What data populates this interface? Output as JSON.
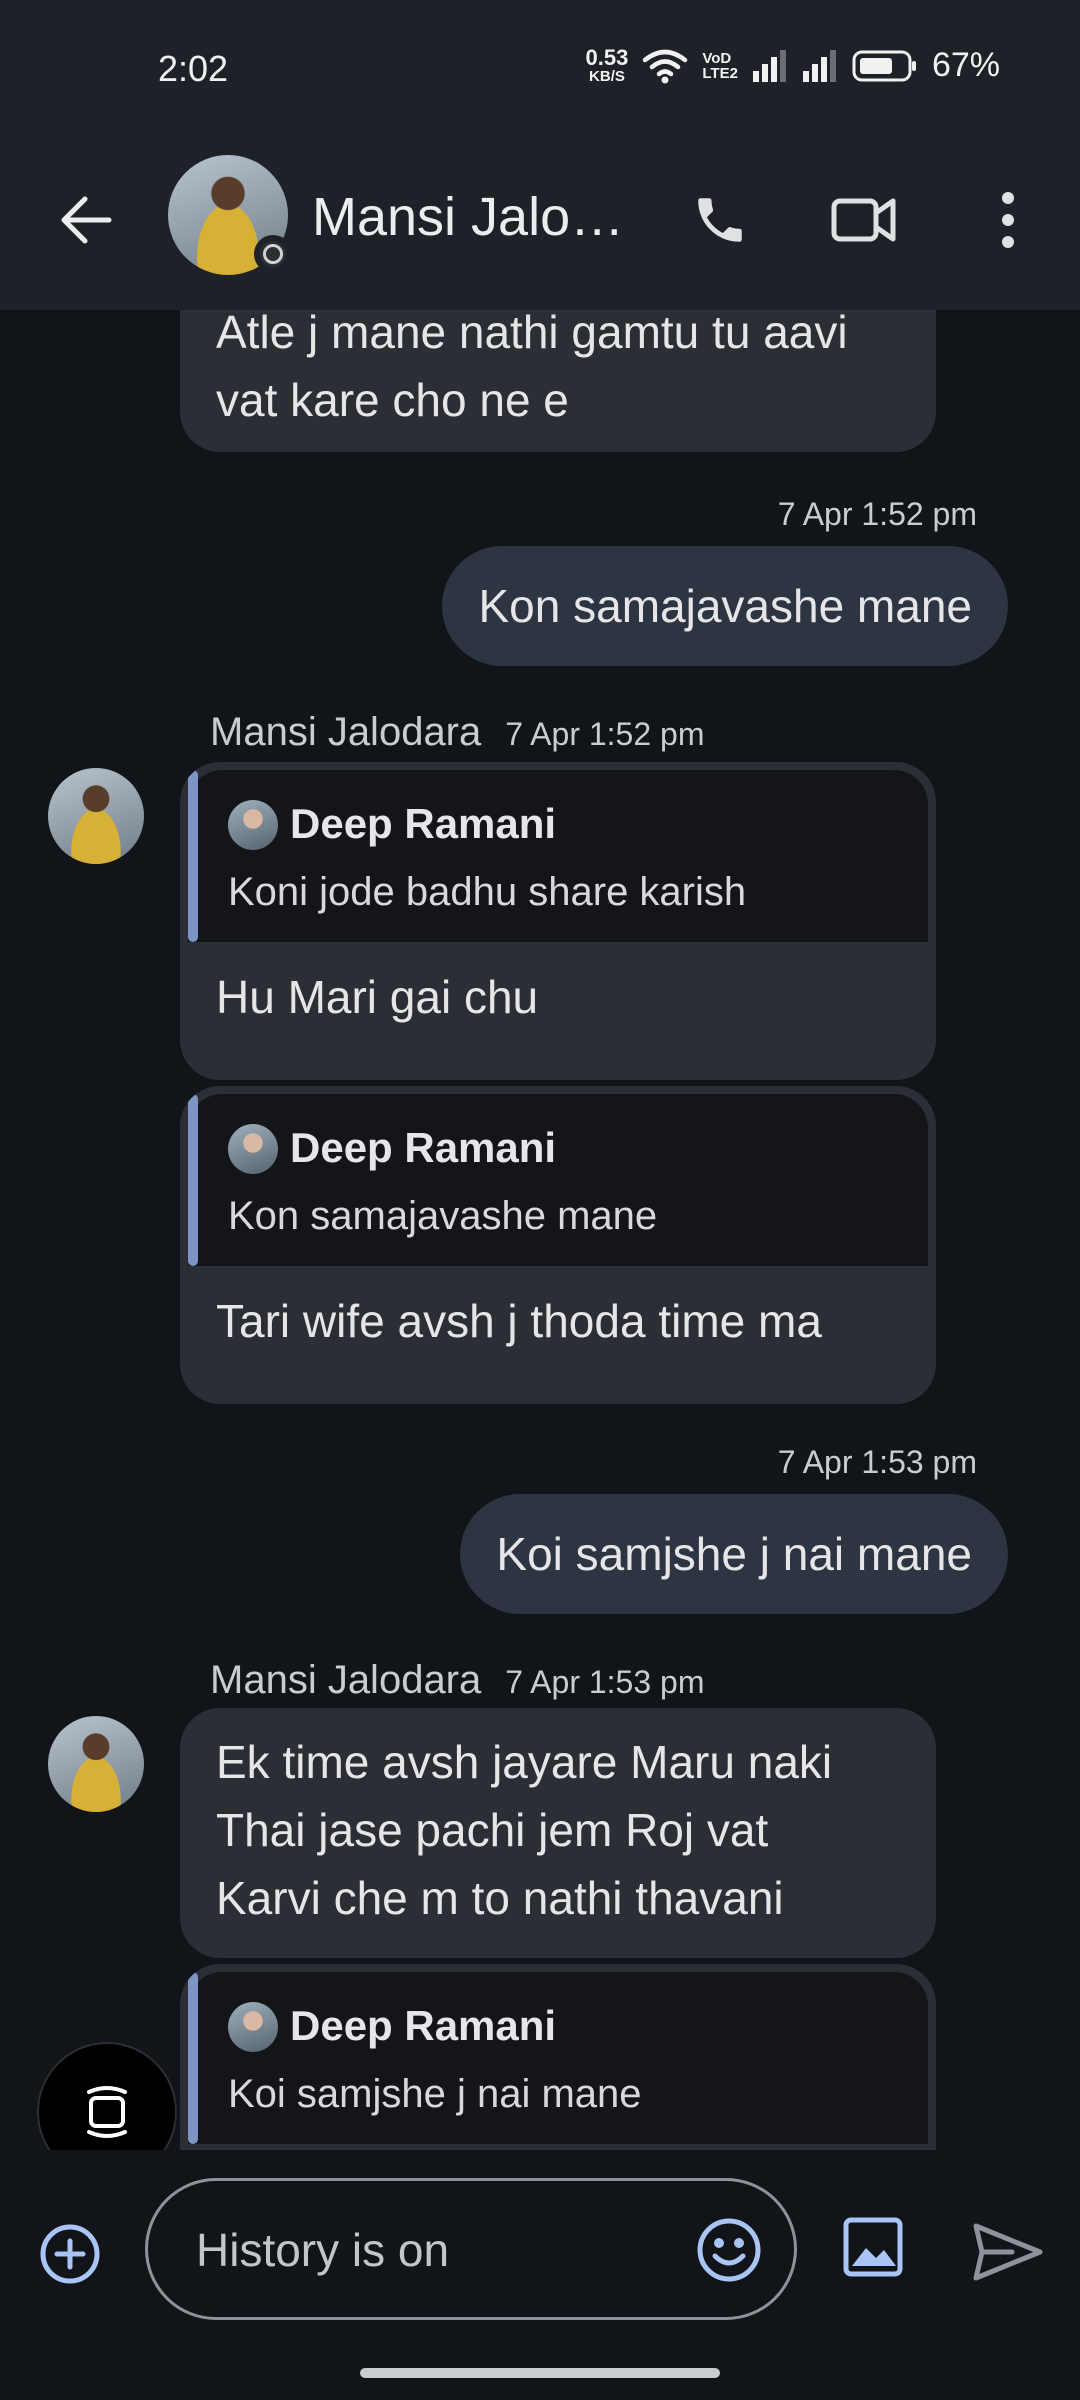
{
  "status_bar": {
    "time": "2:02",
    "net_speed_value": "0.53",
    "net_speed_unit": "KB/S",
    "volte_top": "VoD",
    "volte_bottom": "LTE2",
    "battery": "67%"
  },
  "header": {
    "contact_name": "Mansi Jalo…",
    "back_icon": "arrow-back-icon",
    "call_icon": "phone-icon",
    "video_icon": "video-camera-icon",
    "menu_icon": "more-vert-icon"
  },
  "messages": {
    "m1": {
      "text_line1": "Atle j mane nathi gamtu tu aavi",
      "text_line2": "vat kare cho ne e"
    },
    "m2": {
      "timestamp": "7 Apr 1:52 pm",
      "text": "Kon samajavashe mane"
    },
    "m3": {
      "sender": "Mansi Jalodara",
      "time": "7 Apr 1:52 pm",
      "quote_author": "Deep Ramani",
      "quote_text": "Koni jode badhu share karish",
      "text": "Hu Mari gai chu"
    },
    "m4": {
      "quote_author": "Deep Ramani",
      "quote_text": "Kon samajavashe mane",
      "text": "Tari wife avsh j thoda time ma"
    },
    "m5": {
      "timestamp": "7 Apr 1:53 pm",
      "text": "Koi samjshe j nai mane"
    },
    "m6": {
      "sender": "Mansi Jalodara",
      "time": "7 Apr 1:53 pm",
      "line1": "Ek time avsh jayare Maru naki",
      "line2": "Thai jase pachi jem Roj vat",
      "line3": "Karvi che m to nathi thavani"
    },
    "m7": {
      "quote_author": "Deep Ramani",
      "quote_text": "Koi samjshe j nai mane"
    }
  },
  "composer": {
    "placeholder": "History is on"
  },
  "colors": {
    "background": "#111418",
    "bar": "#1e2228",
    "incoming_bubble": "#2b2e35",
    "outgoing_bubble": "#2d3442",
    "quote_accent": "#7d95c4",
    "icon_blue": "#a8c5f5"
  }
}
